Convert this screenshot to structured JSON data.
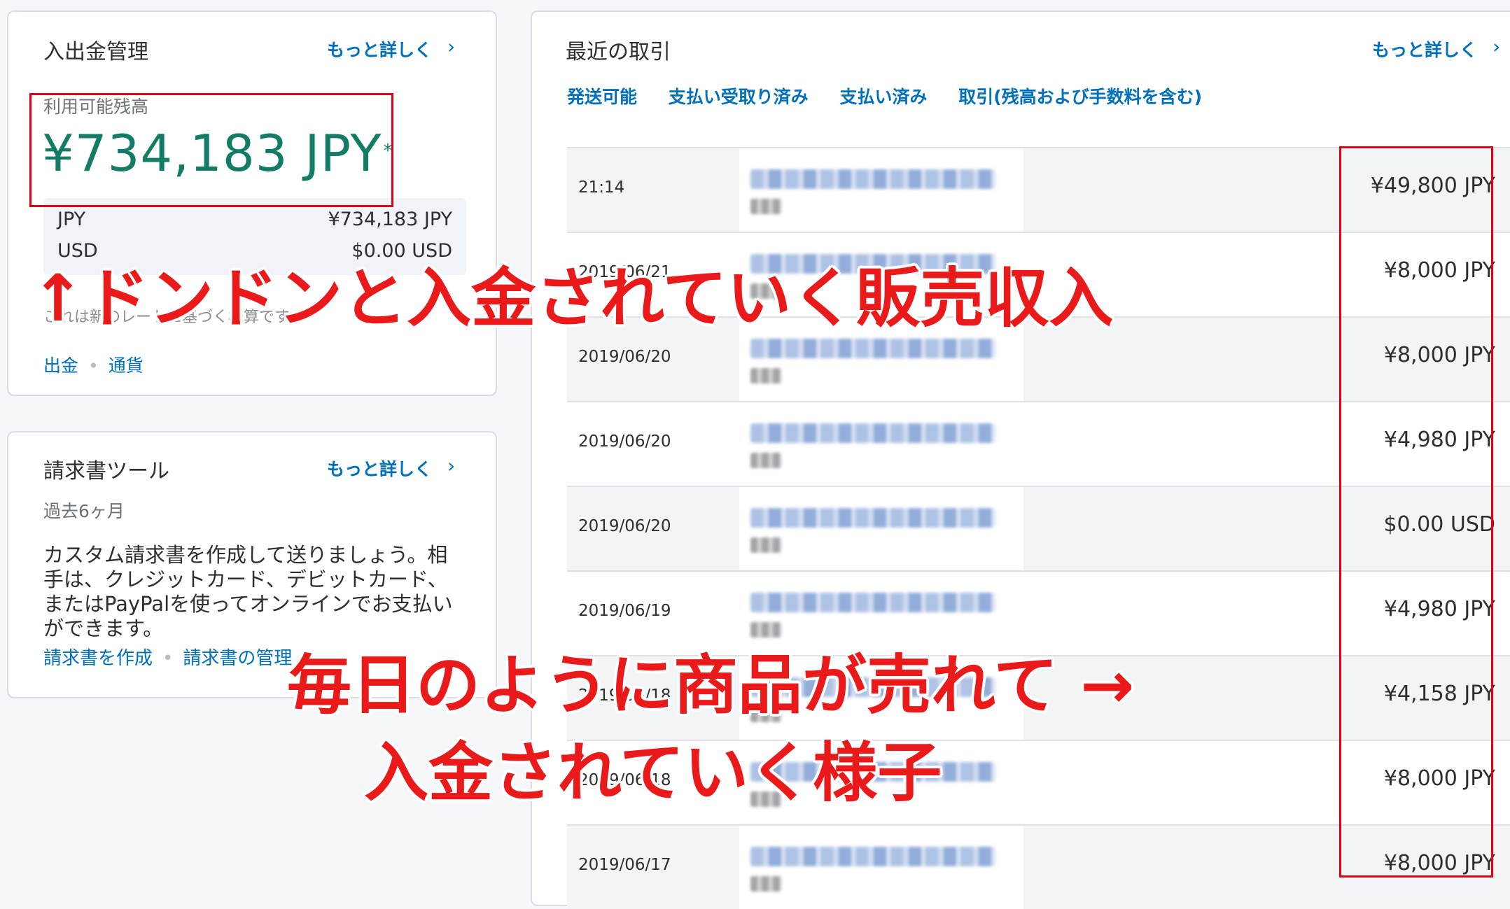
{
  "balance_card": {
    "title": "入出金管理",
    "more": "もっと詳しく",
    "available_label": "利用可能残高",
    "available_amount": "¥734,183 JPY",
    "asterisk": "*",
    "currencies": [
      {
        "code": "JPY",
        "value": "¥734,183 JPY"
      },
      {
        "code": "USD",
        "value": "$0.00 USD"
      }
    ],
    "note": "これは新のレートに基づく概算です",
    "links": [
      "出金",
      "通貨"
    ]
  },
  "invoice_card": {
    "title": "請求書ツール",
    "more": "もっと詳しく",
    "subtitle": "過去6ヶ月",
    "description": "カスタム請求書を作成して送りましょう。相手は、クレジットカード、デビットカード、またはPayPalを使ってオンラインでお支払いができます。",
    "links": [
      "請求書を作成",
      "請求書の管理"
    ]
  },
  "transactions": {
    "title": "最近の取引",
    "more": "もっと詳しく",
    "tabs": [
      "発送可能",
      "支払い受取り済み",
      "支払い済み",
      "取引(残高および手数料を含む)"
    ],
    "rows": [
      {
        "date": "21:14",
        "amount": "¥49,800 JPY"
      },
      {
        "date": "2019/06/21",
        "amount": "¥8,000 JPY"
      },
      {
        "date": "2019/06/20",
        "amount": "¥8,000 JPY"
      },
      {
        "date": "2019/06/20",
        "amount": "¥4,980 JPY"
      },
      {
        "date": "2019/06/20",
        "amount": "$0.00 USD"
      },
      {
        "date": "2019/06/19",
        "amount": "¥4,980 JPY"
      },
      {
        "date": "2019/06/18",
        "amount": "¥4,158 JPY"
      },
      {
        "date": "2019/06/18",
        "amount": "¥8,000 JPY"
      },
      {
        "date": "2019/06/17",
        "amount": "¥8,000 JPY"
      }
    ]
  },
  "annotations": {
    "income_text": "↑ドンドンと入金されていく販売収入",
    "daily_line1": "毎日のように商品が売れて →",
    "daily_line2": "入金されていく様子"
  },
  "colors": {
    "accent": "#0070ba",
    "balance_green": "#127d64",
    "annotation_red": "#ea1a1a"
  }
}
